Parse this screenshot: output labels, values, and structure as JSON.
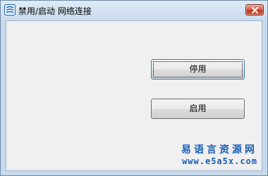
{
  "window": {
    "title": "禁用/启动 网络连接",
    "icon": "app-icon"
  },
  "buttons": {
    "disable_label": "停用",
    "enable_label": "启用"
  },
  "watermark": {
    "site_name": "易语言资源网",
    "url": "www.e5a5x.com"
  },
  "colors": {
    "title_bg": "#c7d9ec",
    "client_bg": "#f0f0f0",
    "close_red": "#c0391f",
    "watermark": "#1a5fb4"
  }
}
